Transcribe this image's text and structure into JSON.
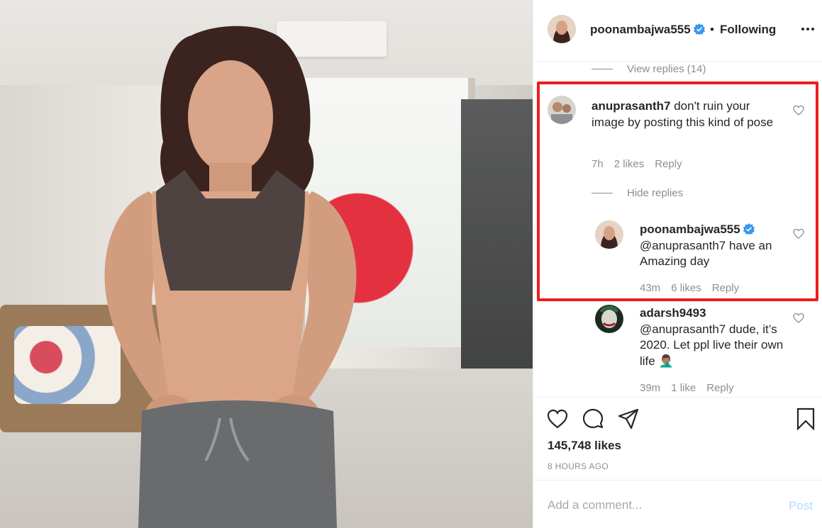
{
  "post": {
    "username": "poonambajwa555",
    "separator": "•",
    "follow_status": "Following",
    "more_icon": "more-horizontal-icon"
  },
  "comments": {
    "view_replies_label": "View replies (14)",
    "hide_replies_label": "Hide replies",
    "items": [
      {
        "username": "anuprasanth7",
        "text": "don't ruin your image by posting this kind of pose",
        "age": "7h",
        "likes": "2 likes",
        "reply": "Reply"
      },
      {
        "username": "poonambajwa555",
        "mention": "@anuprasanth7",
        "text": "have an Amazing day",
        "age": "43m",
        "likes": "6 likes",
        "reply": "Reply"
      },
      {
        "username": "adarsh9493",
        "mention": "@anuprasanth7",
        "text": "dude, it’s 2020. Let ppl live their own life 🤦🏽‍♂️",
        "age": "39m",
        "likes": "1 like",
        "reply": "Reply"
      }
    ]
  },
  "actions": {
    "likes_count": "145,748 likes",
    "timestamp": "8 HOURS AGO"
  },
  "add_comment": {
    "placeholder": "Add a comment...",
    "post_label": "Post"
  },
  "colors": {
    "highlight": "#ee1c1c",
    "verified": "#3897f0",
    "muted": "#8e8e8e",
    "post_disabled": "#b3dbff"
  }
}
